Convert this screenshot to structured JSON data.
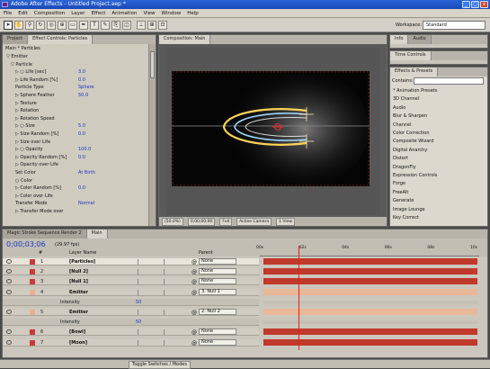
{
  "window": {
    "title": "Adobe After Effects - Untitled Project.aep *",
    "controls": [
      "_",
      "□",
      "x"
    ]
  },
  "menu": [
    "File",
    "Edit",
    "Composition",
    "Layer",
    "Effect",
    "Animation",
    "View",
    "Window",
    "Help"
  ],
  "toolbar": {
    "workspace_label": "Workspace:",
    "workspace_value": "Standard"
  },
  "effect_controls": {
    "tabs": [
      "Project",
      "Effect Controls: Particles"
    ],
    "header": "Main * Particles",
    "rows": [
      {
        "indent": 0,
        "label": "▽ Emitter",
        "value": ""
      },
      {
        "indent": 1,
        "label": "▽ Particle",
        "value": ""
      },
      {
        "indent": 2,
        "label": "▷ ○ Life [sec]",
        "value": "3.0"
      },
      {
        "indent": 2,
        "label": "▷ Life Random [%]",
        "value": "0.0"
      },
      {
        "indent": 2,
        "label": "Particle Type",
        "value": "Sphere"
      },
      {
        "indent": 2,
        "label": "▷ Sphere Feather",
        "value": "50.0"
      },
      {
        "indent": 2,
        "label": "▷ Texture",
        "value": ""
      },
      {
        "indent": 2,
        "label": "▷ Rotation",
        "value": ""
      },
      {
        "indent": 2,
        "label": "▷ Rotation Speed",
        "value": ""
      },
      {
        "indent": 2,
        "label": "▷ ○ Size",
        "value": "5.0"
      },
      {
        "indent": 2,
        "label": "▷ Size Random [%]",
        "value": "0.0"
      },
      {
        "indent": 2,
        "label": "▷ Size over Life",
        "value": ""
      },
      {
        "indent": 2,
        "label": "▷ ○ Opacity",
        "value": "100.0"
      },
      {
        "indent": 2,
        "label": "▷ Opacity Random [%]",
        "value": "0.0"
      },
      {
        "indent": 2,
        "label": "▷ Opacity over Life",
        "value": ""
      },
      {
        "indent": 2,
        "label": "Set Color",
        "value": "At Birth"
      },
      {
        "indent": 2,
        "label": "○ Color",
        "value": ""
      },
      {
        "indent": 2,
        "label": "▷ Color Random [%]",
        "value": "0.0"
      },
      {
        "indent": 2,
        "label": "▷ Color over Life",
        "value": ""
      },
      {
        "indent": 2,
        "label": "Transfer Mode",
        "value": "Normal"
      },
      {
        "indent": 2,
        "label": "▷ Transfer Mode over",
        "value": ""
      }
    ]
  },
  "composition": {
    "tab": "Composition: Main",
    "zoom": "(50.0%)",
    "timecode": "0;00;00;00",
    "quality": "Full",
    "camera": "Active Camera",
    "view": "1 View"
  },
  "right_panel": {
    "info_tabs": [
      "Info",
      "Audio"
    ],
    "time_controls": "Time Controls",
    "effects_tab": "Effects & Presets",
    "contains_label": "Contains:",
    "items": [
      "* Animation Presets",
      "3D Channel",
      "Audio",
      "Blur & Sharpen",
      "Channel",
      "Color Correction",
      "Composite Wizard",
      "Digital Anarchy",
      "Distort",
      "DragonFly",
      "Expression Controls",
      "Forge",
      "FreeAlt",
      "Generate",
      "Image Lounge",
      "Key Correct"
    ]
  },
  "timeline": {
    "tabs": [
      "Magic Stroke Sequence Render 2",
      "Main"
    ],
    "timecode": "0;00;03;06",
    "fps": "(29.97 fps)",
    "columns": [
      "#",
      "Layer Name",
      "Parent"
    ],
    "layers": [
      {
        "num": "1",
        "name": "[Particles]",
        "parent": "None",
        "color": "#c83a3a",
        "bar": "#c0392b",
        "selected": true
      },
      {
        "num": "2",
        "name": "[Null 2]",
        "parent": "None",
        "color": "#c83a3a",
        "bar": "#c0392b"
      },
      {
        "num": "3",
        "name": "[Null 1]",
        "parent": "None",
        "color": "#c83a3a",
        "bar": "#c0392b"
      },
      {
        "num": "4",
        "name": "Emitter",
        "parent": "3. Null 1",
        "color": "#e8b090",
        "bar": "#e8b898"
      },
      {
        "num": "",
        "name": "Intensity",
        "parent": "",
        "color": "",
        "bar": "",
        "sub": true,
        "value": "50"
      },
      {
        "num": "5",
        "name": "Emitter",
        "parent": "2. Null 2",
        "color": "#e8b090",
        "bar": "#e8b898"
      },
      {
        "num": "",
        "name": "Intensity",
        "parent": "",
        "color": "",
        "bar": "",
        "sub": true,
        "value": "50"
      },
      {
        "num": "6",
        "name": "[Bowl]",
        "parent": "None",
        "color": "#c83a3a",
        "bar": "#c0392b"
      },
      {
        "num": "7",
        "name": "[Moon]",
        "parent": "None",
        "color": "#c83a3a",
        "bar": "#c0392b"
      }
    ],
    "ruler": [
      "00s",
      "02s",
      "04s",
      "06s",
      "08s",
      "10s"
    ],
    "current_time_fraction": 0.165,
    "toggle_label": "Toggle Switches / Modes"
  }
}
